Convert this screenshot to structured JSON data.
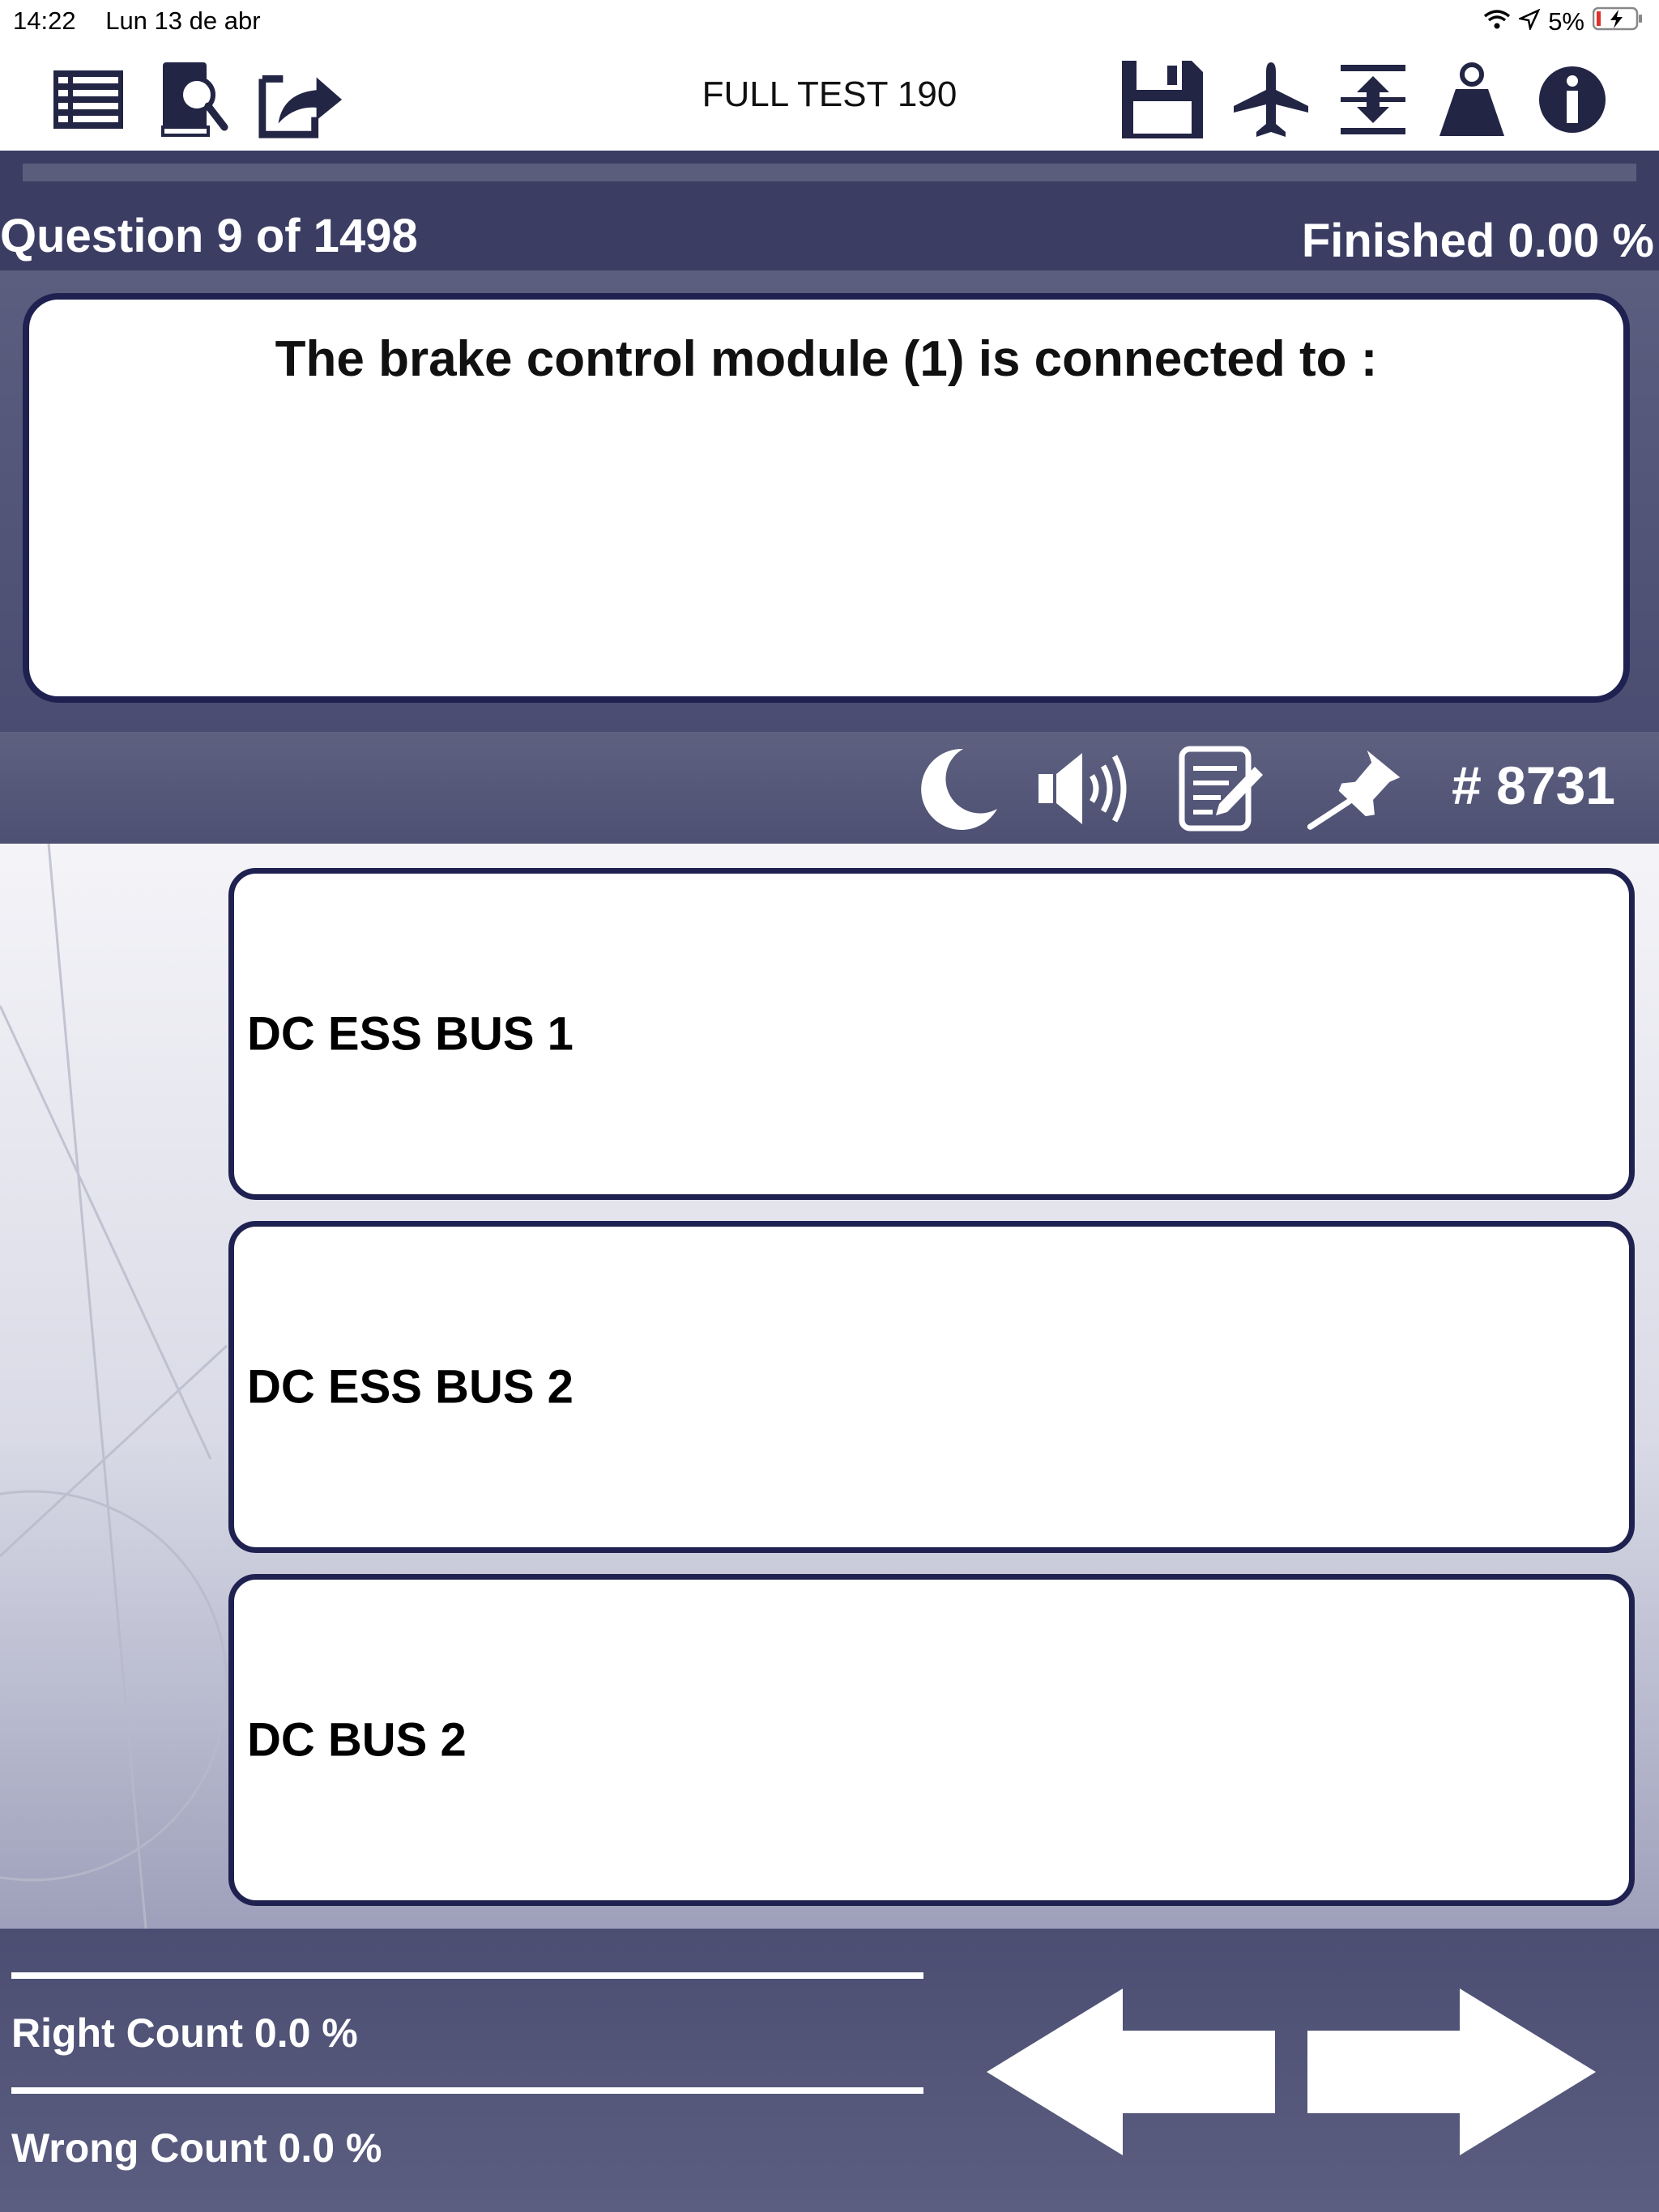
{
  "status_bar": {
    "time": "14:22",
    "date": "Lun 13 de abr",
    "battery": "5%",
    "icons": [
      "wifi-icon",
      "location-icon",
      "battery-charging-icon"
    ]
  },
  "toolbar": {
    "title": "FULL TEST 190",
    "left_icons": [
      "list-icon",
      "book-search-icon",
      "share-icon"
    ],
    "right_icons": [
      "save-icon",
      "airplane-icon",
      "expand-icon",
      "weight-icon",
      "info-icon"
    ]
  },
  "header": {
    "question_label": "Question 9 of 1498",
    "finished_label": "Finished 0.00 %",
    "progress": 0.0
  },
  "question": {
    "text": "The brake control module (1)  is connected to :"
  },
  "question_tools": {
    "icons": [
      "moon-icon",
      "speaker-icon",
      "note-edit-icon",
      "pin-icon"
    ],
    "id_label": "# 8731"
  },
  "answers": [
    {
      "label": "DC ESS BUS 1"
    },
    {
      "label": "DC ESS BUS 2"
    },
    {
      "label": "DC BUS 2"
    }
  ],
  "stats": {
    "right_label": "Right Count 0.0  %",
    "wrong_label": "Wrong Count 0.0  %"
  },
  "nav": {
    "icons": [
      "arrow-left-icon",
      "arrow-right-icon"
    ]
  },
  "colors": {
    "dark_band": "#3b3d63",
    "border": "#1f2150",
    "accent_white": "#ffffff"
  }
}
